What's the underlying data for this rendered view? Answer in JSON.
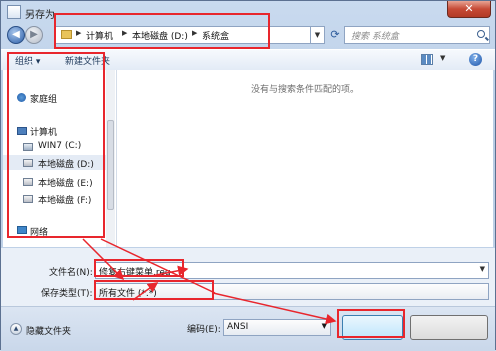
{
  "window": {
    "title": "另存为"
  },
  "address": {
    "crumbs": [
      "计算机",
      "本地磁盘 (D:)",
      "系统盒"
    ]
  },
  "search": {
    "placeholder": "搜索 系统盒"
  },
  "toolbar": {
    "organize": "组织 ▾",
    "new_folder": "新建文件夹"
  },
  "nav": {
    "homegroup": "家庭组",
    "computer": "计算机",
    "drives": [
      "WIN7 (C:)",
      "本地磁盘 (D:)",
      "本地磁盘 (E:)",
      "本地磁盘 (F:)"
    ],
    "network": "网络"
  },
  "content": {
    "empty_message": "没有与搜索条件匹配的项。"
  },
  "form": {
    "filename_label": "文件名(N):",
    "filename_value": "修复右键菜单.reg",
    "filetype_label": "保存类型(T):",
    "filetype_value": "所有文件 (*.*)"
  },
  "bottom": {
    "hide_folders": "隐藏文件夹",
    "encoding_label": "编码(E):",
    "encoding_value": "ANSI",
    "save_label": "",
    "cancel_label": ""
  },
  "colors": {
    "annotation": "#e8262d",
    "window_frame": "#5c7191"
  }
}
